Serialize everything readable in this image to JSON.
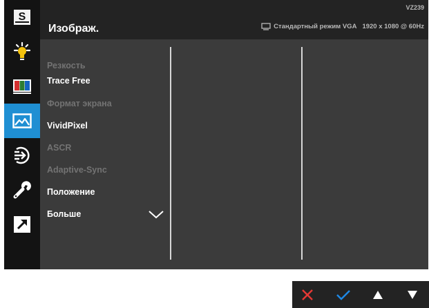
{
  "header": {
    "title": "Изображ.",
    "model": "VZ239",
    "mode_text": "Стандартный режим VGA",
    "resolution_text": "1920 x 1080 @ 60Hz"
  },
  "sidebar": {
    "items": [
      {
        "name": "splendid",
        "icon": "s-icon",
        "label": "S",
        "active": false
      },
      {
        "name": "blue-light-filter",
        "icon": "light-bulb-icon",
        "active": false
      },
      {
        "name": "color",
        "icon": "color-bars-icon",
        "active": false
      },
      {
        "name": "image",
        "icon": "picture-icon",
        "active": true
      },
      {
        "name": "input-select",
        "icon": "input-select-icon",
        "active": false
      },
      {
        "name": "system-setup",
        "icon": "wrench-icon",
        "active": false
      },
      {
        "name": "shortcut",
        "icon": "shortcut-arrow-icon",
        "active": false
      }
    ]
  },
  "menu": {
    "items": [
      {
        "label": "Резкость",
        "enabled": false
      },
      {
        "label": "Trace Free",
        "enabled": true
      },
      {
        "label": "Формат экрана",
        "enabled": false
      },
      {
        "label": "VividPixel",
        "enabled": true
      },
      {
        "label": "ASCR",
        "enabled": false
      },
      {
        "label": "Adaptive-Sync",
        "enabled": false
      },
      {
        "label": "Положение",
        "enabled": true
      },
      {
        "label": "Больше",
        "enabled": true
      }
    ]
  },
  "keys": [
    {
      "name": "close",
      "icon": "close-icon",
      "color": "#e53935"
    },
    {
      "name": "confirm",
      "icon": "check-icon",
      "color": "#1e88e5"
    },
    {
      "name": "up",
      "icon": "triangle-up-icon",
      "color": "#ffffff"
    },
    {
      "name": "down",
      "icon": "triangle-down-icon",
      "color": "#ffffff"
    }
  ],
  "colors": {
    "accent": "#1f8fd3"
  }
}
